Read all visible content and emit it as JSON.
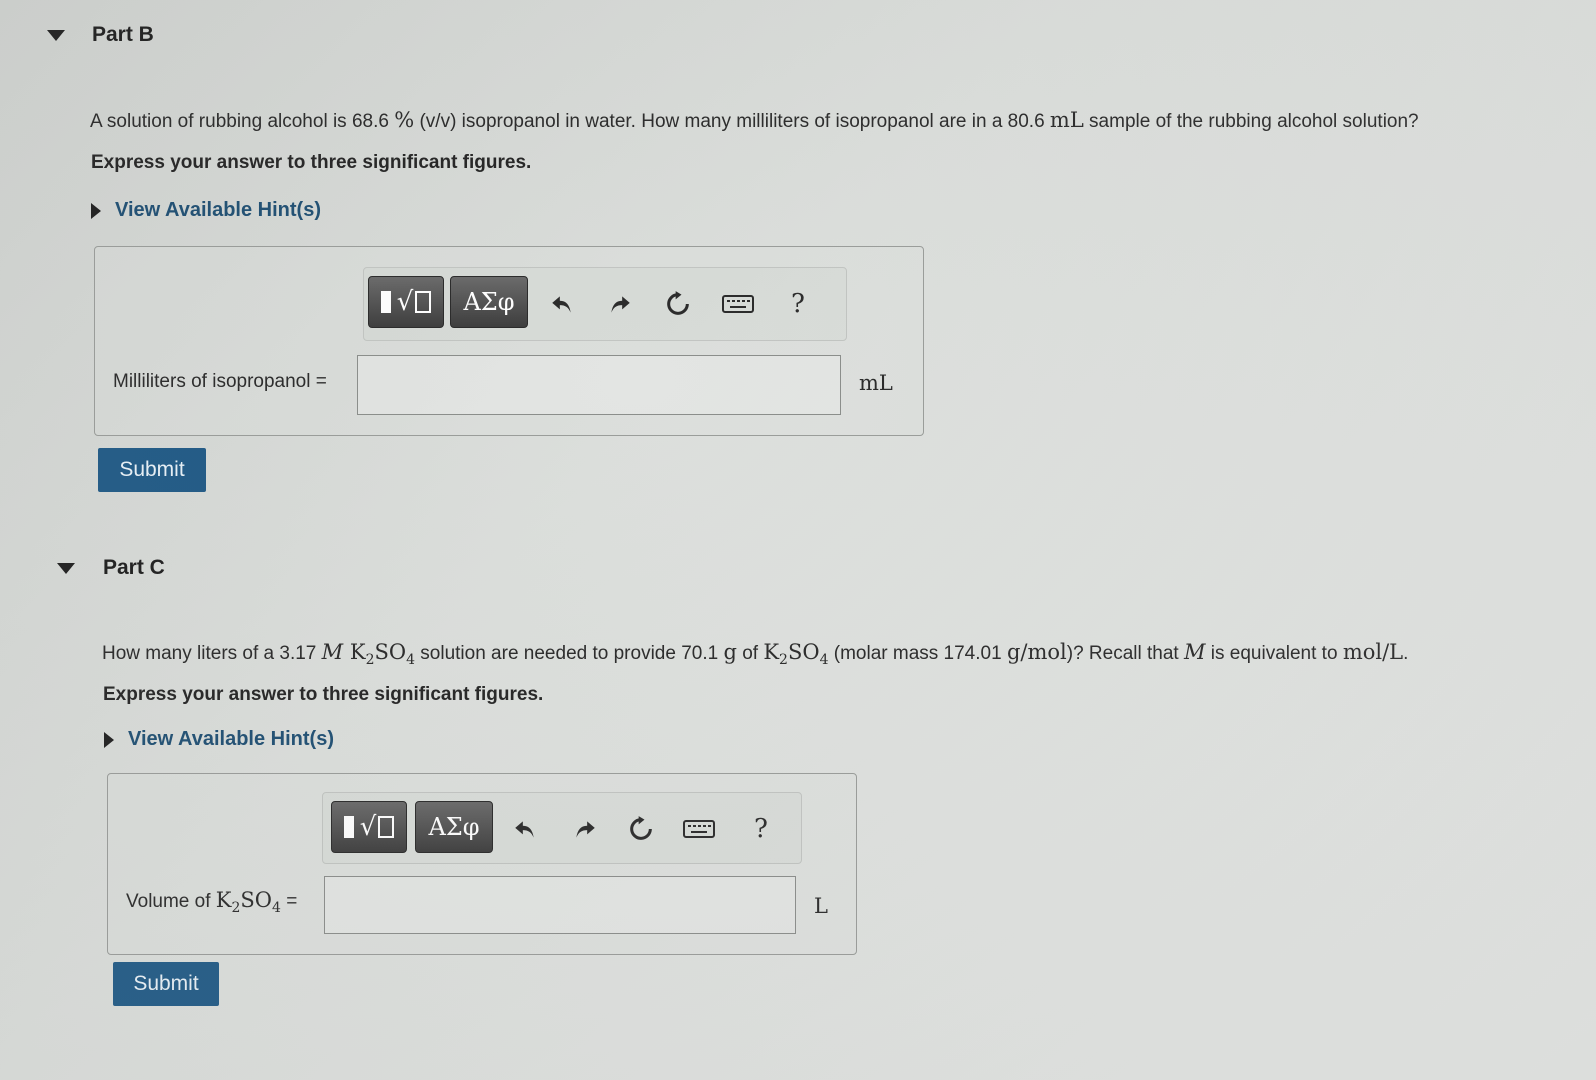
{
  "part_b": {
    "title": "Part B",
    "question": {
      "t1": "A solution of rubbing alcohol is 68.6 ",
      "m1": "%",
      "t2": " (v/v) isopropanol in water. How many milliliters of isopropanol are in a 80.6 ",
      "m2": "mL",
      "t3": " sample of the rubbing alcohol solution?"
    },
    "instruction": "Express your answer to three significant figures.",
    "hint": "View Available Hint(s)",
    "toolbar": {
      "template_glyph": "√",
      "greek_label": "ΑΣφ",
      "help_label": "?"
    },
    "answer_label": "Milliliters of isopropanol =",
    "answer_value": "",
    "unit": "mL",
    "submit_label": "Submit"
  },
  "part_c": {
    "title": "Part C",
    "question": {
      "t1": "How many liters of a 3.17 ",
      "m1": "M",
      "m1b": "K",
      "s1": "2",
      "m1c": "SO",
      "s1b": "4",
      "t2": " solution are needed to provide 70.1 ",
      "m2": "g",
      "t3": " of ",
      "m3": "K",
      "s3": "2",
      "m3b": "SO",
      "s3b": "4",
      "t4": " (molar mass 174.01 ",
      "m4": "g/mol",
      "t5": ")? Recall that ",
      "m5": "M",
      "t6": " is equivalent to ",
      "m6": "mol/L",
      "t7": "."
    },
    "instruction": "Express your answer to three significant figures.",
    "hint": "View Available Hint(s)",
    "toolbar": {
      "template_glyph": "√",
      "greek_label": "ΑΣφ",
      "help_label": "?"
    },
    "answer_label": {
      "pre": "Volume of ",
      "k": "K",
      "s1": "2",
      "so": "SO",
      "s2": "4",
      "eq": " ="
    },
    "answer_value": "",
    "unit": "L",
    "submit_label": "Submit"
  }
}
